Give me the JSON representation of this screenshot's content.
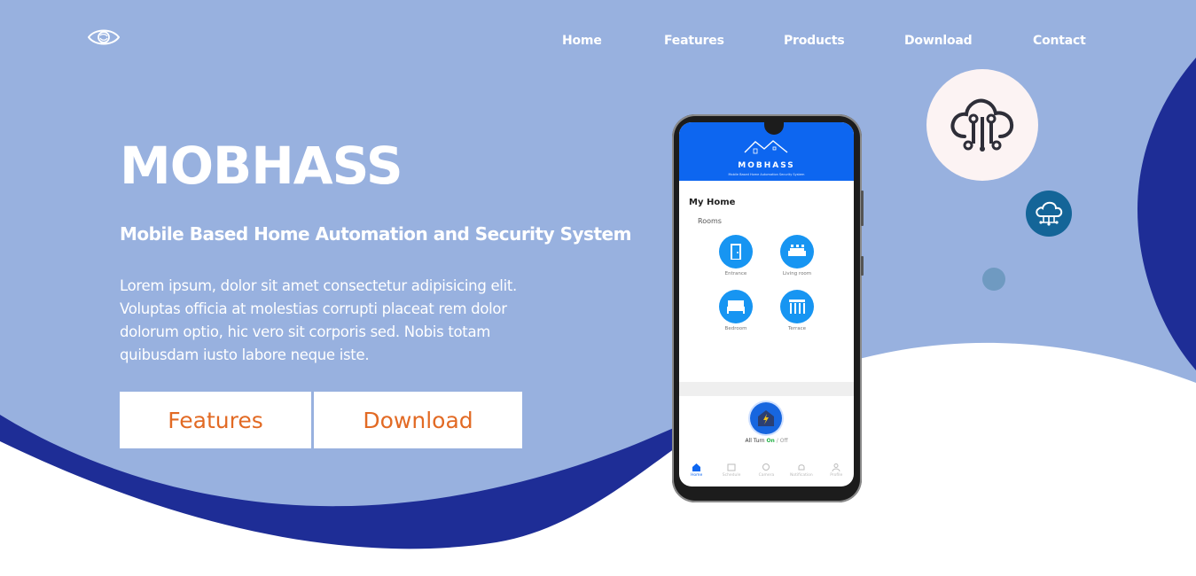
{
  "brand": {
    "logo_icon": "eye-icon"
  },
  "nav": {
    "items": [
      {
        "label": "Home"
      },
      {
        "label": "Features"
      },
      {
        "label": "Products"
      },
      {
        "label": "Download"
      },
      {
        "label": "Contact"
      }
    ]
  },
  "hero": {
    "title": "MOBHASS",
    "subtitle": "Mobile Based Home Automation and Security System",
    "description": "Lorem ipsum, dolor sit amet consectetur adipisicing elit. Voluptas officia at molestias corrupti placeat rem dolor dolorum optio, hic vero sit corporis sed. Nobis totam quibusdam iusto labore neque iste.",
    "buttons": {
      "features_label": "Features",
      "download_label": "Download"
    }
  },
  "phone": {
    "app_brand": "MOBHASS",
    "app_tagline": "Mobile Based Home Automation Security System",
    "section_title": "My Home",
    "rooms_label": "Rooms",
    "rooms": [
      {
        "label": "Entrance",
        "icon": "door-icon"
      },
      {
        "label": "Living room",
        "icon": "sofa-icon"
      },
      {
        "label": "Bedroom",
        "icon": "bed-icon"
      },
      {
        "label": "Terrace",
        "icon": "terrace-icon"
      }
    ],
    "all_turn": {
      "prefix": "All Turn",
      "on": "On",
      "sep": "/",
      "off": "Off"
    },
    "tabs": [
      {
        "label": "Home",
        "icon": "home-icon"
      },
      {
        "label": "Schedule",
        "icon": "calendar-icon"
      },
      {
        "label": "Camera",
        "icon": "camera-icon"
      },
      {
        "label": "Notification",
        "icon": "bell-icon"
      },
      {
        "label": "Profile",
        "icon": "user-icon"
      }
    ]
  },
  "decor": {
    "big_icon": "cloud-circuit-icon",
    "small_icon": "cloud-network-icon"
  },
  "colors": {
    "hero_bg": "#98b1df",
    "wave_dark": "#1e2d96",
    "button_text": "#e26a24",
    "app_blue": "#0d66f0"
  }
}
